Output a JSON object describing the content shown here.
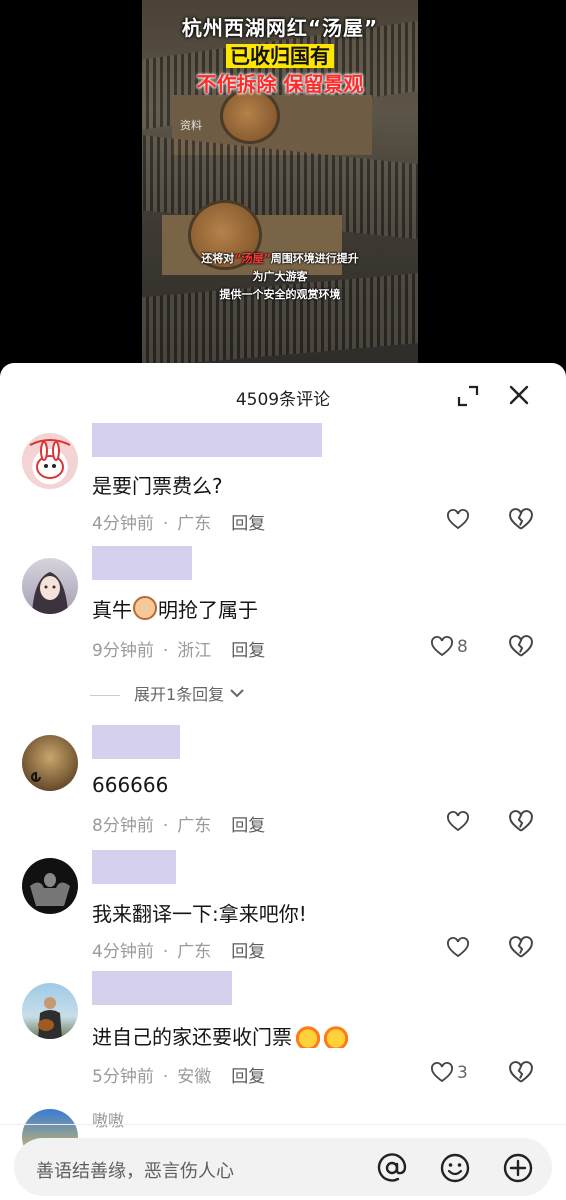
{
  "video": {
    "title_line1": "杭州西湖网红“汤屋”",
    "title_line2": "已收归国有",
    "title_line3": "不作拆除 保留景观",
    "watermark": "资料",
    "subtitle_prefix": "还将对",
    "subtitle_highlight": "“汤屋”",
    "subtitle_suffix": "周围环境进行提升",
    "subtitle_line2": "为广大游客",
    "subtitle_line3": "提供一个安全的观赏环境"
  },
  "panel": {
    "comment_count": "4509条评论",
    "input_placeholder": "善语结善缘，恶言伤人心"
  },
  "comments": [
    {
      "text": "是要门票费么?",
      "time": "4分钟前",
      "location": "广东",
      "reply": "回复",
      "likes": ""
    },
    {
      "text_before": "真牛",
      "text_after": "明抢了属于",
      "time": "9分钟前",
      "location": "浙江",
      "reply": "回复",
      "likes": "8",
      "expand": "展开1条回复"
    },
    {
      "text": "666666",
      "time": "8分钟前",
      "location": "广东",
      "reply": "回复",
      "likes": ""
    },
    {
      "text": "我来翻译一下:拿来吧你!",
      "time": "4分钟前",
      "location": "广东",
      "reply": "回复",
      "likes": ""
    },
    {
      "text": "进自己的家还要收门票",
      "time": "5分钟前",
      "location": "安徽",
      "reply": "回复",
      "likes": "3"
    }
  ],
  "partial_comment": {
    "name": "嗷嗷"
  },
  "colors": {
    "name_redaction": "#d6d0ef",
    "accent_red": "#ff2a2a",
    "highlight_yellow": "#ffe600"
  }
}
